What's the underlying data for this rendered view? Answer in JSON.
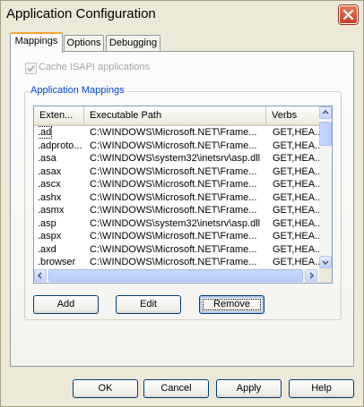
{
  "window": {
    "title": "Application Configuration"
  },
  "tabs": [
    {
      "label": "Mappings",
      "active": true
    },
    {
      "label": "Options",
      "active": false
    },
    {
      "label": "Debugging",
      "active": false
    }
  ],
  "cache_isapi": {
    "label": "Cache ISAPI applications",
    "checked": true,
    "enabled": false
  },
  "mappings_group": {
    "label": "Application Mappings"
  },
  "table": {
    "columns": [
      "Exten...",
      "Executable Path",
      "Verbs"
    ],
    "rows": [
      [
        ".ad",
        "C:\\WINDOWS\\Microsoft.NET\\Frame...",
        "GET,HEA..."
      ],
      [
        ".adproto...",
        "C:\\WINDOWS\\Microsoft.NET\\Frame...",
        "GET,HEA..."
      ],
      [
        ".asa",
        "C:\\WINDOWS\\system32\\inetsrv\\asp.dll",
        "GET,HEA..."
      ],
      [
        ".asax",
        "C:\\WINDOWS\\Microsoft.NET\\Frame...",
        "GET,HEA..."
      ],
      [
        ".ascx",
        "C:\\WINDOWS\\Microsoft.NET\\Frame...",
        "GET,HEA..."
      ],
      [
        ".ashx",
        "C:\\WINDOWS\\Microsoft.NET\\Frame...",
        "GET,HEA..."
      ],
      [
        ".asmx",
        "C:\\WINDOWS\\Microsoft.NET\\Frame...",
        "GET,HEA..."
      ],
      [
        ".asp",
        "C:\\WINDOWS\\system32\\inetsrv\\asp.dll",
        "GET,HEA..."
      ],
      [
        ".aspx",
        "C:\\WINDOWS\\Microsoft.NET\\Frame...",
        "GET,HEA..."
      ],
      [
        ".axd",
        "C:\\WINDOWS\\Microsoft.NET\\Frame...",
        "GET,HEA..."
      ],
      [
        ".browser",
        "C:\\WINDOWS\\Microsoft.NET\\Frame...",
        "GET,HEA..."
      ]
    ]
  },
  "group_buttons": {
    "add": "Add",
    "edit": "Edit",
    "remove": "Remove"
  },
  "dialog_buttons": {
    "ok": "OK",
    "cancel": "Cancel",
    "apply": "Apply",
    "help": "Help"
  },
  "colors": {
    "accent_tab": "#f7a533",
    "group_label": "#0046d5",
    "close_button": "#c3432b"
  },
  "icons": {
    "close": "close-icon",
    "check": "checkmark-icon",
    "arrow_up": "scroll-up-icon",
    "arrow_down": "scroll-down-icon",
    "arrow_left": "scroll-left-icon",
    "arrow_right": "scroll-right-icon"
  }
}
